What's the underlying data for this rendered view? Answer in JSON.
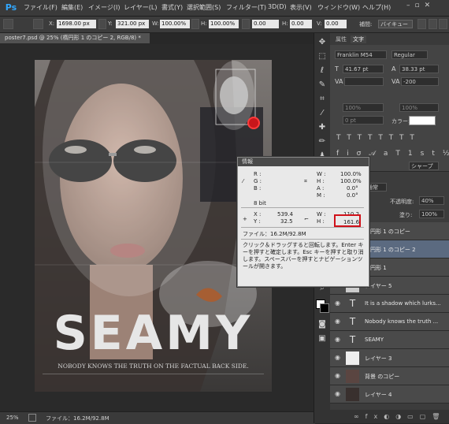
{
  "menubar": {
    "logo": "Ps",
    "items": [
      "ファイル(F)",
      "編集(E)",
      "イメージ(I)",
      "レイヤー(L)",
      "書式(Y)",
      "選択範囲(S)",
      "フィルター(T)",
      "3D(D)",
      "表示(V)",
      "ウィンドウ(W)",
      "ヘルプ(H)"
    ]
  },
  "options": {
    "x_label": "X:",
    "x_value": "1698.00 px",
    "y_label": "Y:",
    "y_value": "321.00 px",
    "w_label": "W:",
    "w_value": "100.00%",
    "h_label": "H:",
    "h_value": "100.00%",
    "angle_value": "0.00",
    "hskew_label": "H:",
    "hskew_value": "0.00",
    "vskew_label": "V:",
    "vskew_value": "0.00",
    "interp_label": "補間:",
    "interp_value": "バイキュー"
  },
  "document": {
    "tab_title": "poster7.psd @ 25% (楕円形 1 のコピー 2, RGB/8) *",
    "poster_title": "SEAMY",
    "poster_tagline": "NOBODY KNOWS THE TRUTH ON THE FACTUAL BACK SIDE."
  },
  "status": {
    "zoom": "25%",
    "file_info": "ファイル：16.2M/92.8M"
  },
  "character_panel": {
    "tab1": "属性",
    "tab2": "文字",
    "font_family": "Franklin M54",
    "font_style": "Regular",
    "size": "41.67 pt",
    "leading": "38.33 pt",
    "tracking": "-200",
    "scale_v": "100%",
    "scale_h": "100%",
    "baseline": "0 pt",
    "color_label": "カラー:",
    "aa_value": "シャープ"
  },
  "layers_panel": {
    "blend_mode": "通常",
    "opacity_label": "不透明度:",
    "opacity_value": "40%",
    "fill_label": "塗り:",
    "fill_value": "100%",
    "rows": [
      {
        "name": "楕円形 1 のコピー",
        "type": "shape"
      },
      {
        "name": "楕円形 1 のコピー 2",
        "type": "shape"
      },
      {
        "name": "楕円形 1",
        "type": "shape"
      },
      {
        "name": "レイヤー 5",
        "type": "layer"
      },
      {
        "name": "It is a shadow which lurks...",
        "type": "text"
      },
      {
        "name": "Nobody knows the truth ...",
        "type": "text"
      },
      {
        "name": "SEAMY",
        "type": "text"
      },
      {
        "name": "レイヤー 3",
        "type": "layer"
      },
      {
        "name": "背景 のコピー",
        "type": "photo"
      },
      {
        "name": "レイヤー 4",
        "type": "photo"
      }
    ]
  },
  "info_panel": {
    "title": "情報",
    "r_label": "R :",
    "g_label": "G :",
    "b_label": "B :",
    "w_label": "W :",
    "w_value": "100.0%",
    "h_label": "H :",
    "h_value": "100.0%",
    "a_label": "A :",
    "a_value": "0.0°",
    "m_label": "M :",
    "m_value": "0.0°",
    "bit": "8 bit",
    "x_label": "X :",
    "x_value": "539.4",
    "y_label": "Y :",
    "y_value": "32.5",
    "w2_label": "W :",
    "w2_value": "110.2",
    "h2_label": "H :",
    "h2_value": "161.6",
    "file": "ファイル：16.2M/92.8M",
    "message": "クリック＆ドラッグすると回転します。Enter キーを押すと確定します。Esc キーを押すと取り消します。スペースバーを押すとナビゲーションツールが開きます。"
  }
}
